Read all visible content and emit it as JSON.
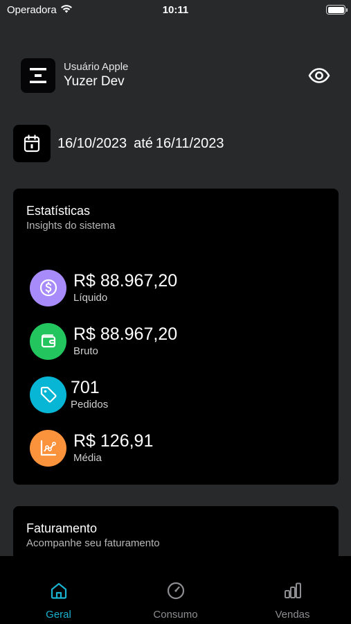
{
  "status_bar": {
    "carrier": "Operadora",
    "time": "10:11"
  },
  "user": {
    "subtitle": "Usuário Apple",
    "name": "Yuzer Dev"
  },
  "date_range": {
    "start": "16/10/2023",
    "connector": "até",
    "end": "16/11/2023"
  },
  "stats": {
    "title": "Estatísticas",
    "subtitle": "Insights do sistema",
    "items": [
      {
        "value": "R$ 88.967,20",
        "label": "Líquido",
        "icon": "dollar-circle-icon",
        "color": "#a78bfa"
      },
      {
        "value": "R$ 88.967,20",
        "label": "Bruto",
        "icon": "wallet-icon",
        "color": "#22c55e"
      },
      {
        "value": "701",
        "label": "Pedidos",
        "icon": "tag-icon",
        "color": "#06b6d4"
      },
      {
        "value": "R$ 126,91",
        "label": "Média",
        "icon": "chart-line-icon",
        "color": "#fb923c"
      }
    ]
  },
  "billing": {
    "title": "Faturamento",
    "subtitle": "Acompanhe seu faturamento"
  },
  "tabs": [
    {
      "label": "Geral",
      "icon": "home-icon",
      "active": true
    },
    {
      "label": "Consumo",
      "icon": "gauge-icon",
      "active": false
    },
    {
      "label": "Vendas",
      "icon": "bar-chart-icon",
      "active": false
    }
  ],
  "colors": {
    "background": "#28292b",
    "card": "#000000",
    "accent": "#1ab3d1",
    "inactive_tab": "#8e8e93"
  }
}
